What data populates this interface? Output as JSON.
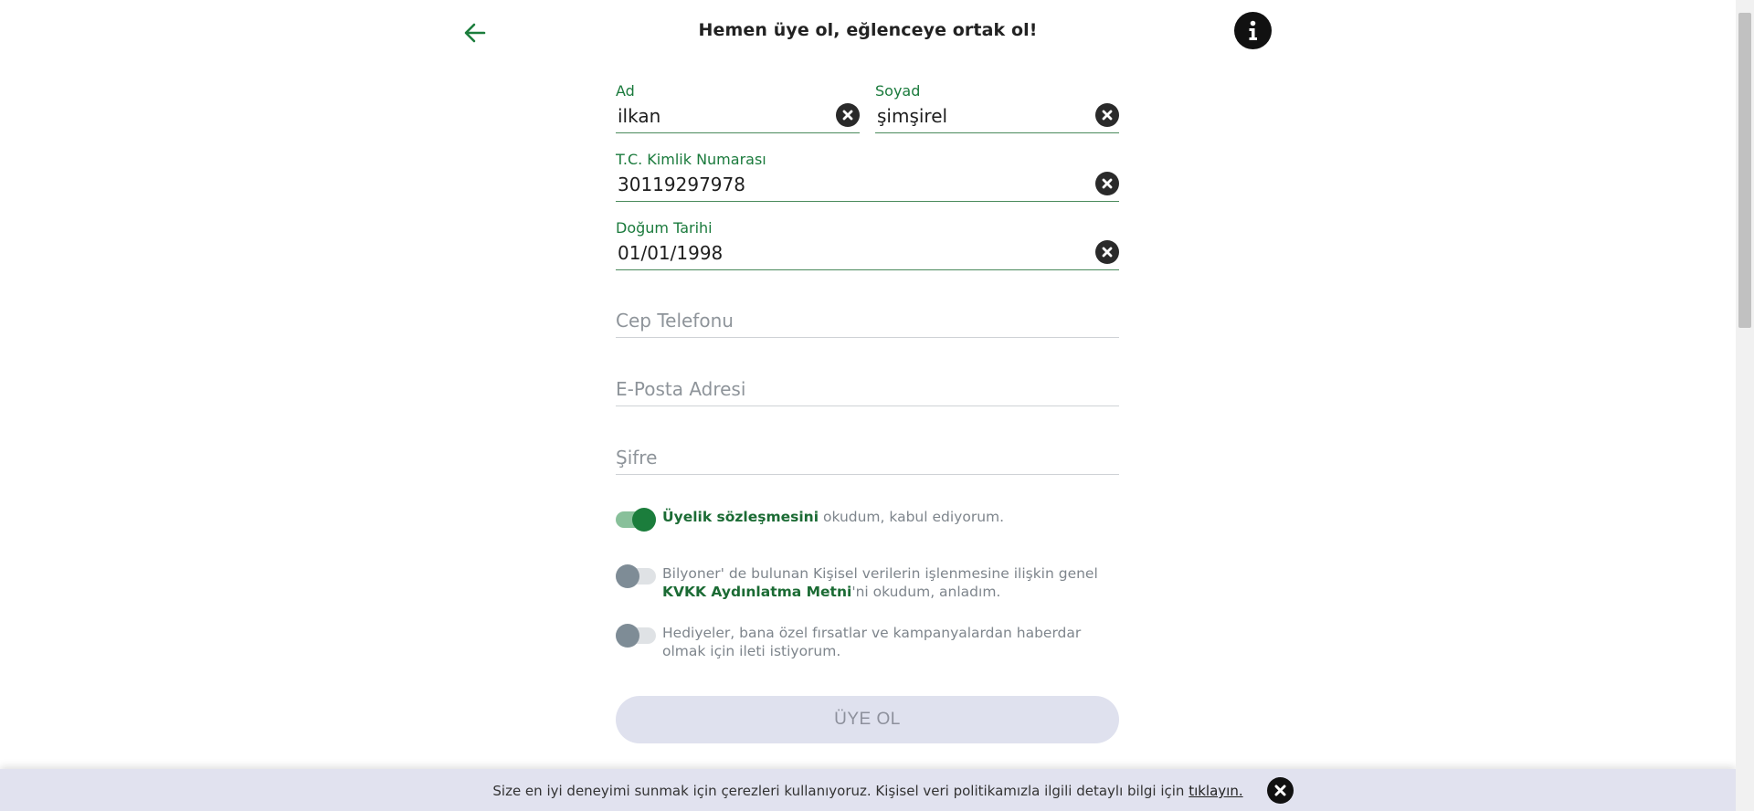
{
  "header": {
    "title": "Hemen üye ol, eğlenceye ortak ol!",
    "back_icon": "arrow-left-icon",
    "info_icon": "info-icon"
  },
  "form": {
    "first_name": {
      "label": "Ad",
      "value": "ilkan"
    },
    "last_name": {
      "label": "Soyad",
      "value": "şimşirel"
    },
    "tc_id": {
      "label": "T.C. Kimlik Numarası",
      "value": "30119297978"
    },
    "birth_date": {
      "label": "Doğum Tarihi",
      "value": "01/01/1998"
    },
    "phone": {
      "placeholder": "Cep Telefonu"
    },
    "email": {
      "placeholder": "E-Posta Adresi"
    },
    "password": {
      "placeholder": "Şifre"
    }
  },
  "consents": [
    {
      "checked": true,
      "link": "Üyelik sözleşmesini",
      "text": " okudum, kabul ediyorum."
    },
    {
      "checked": false,
      "text_before": "Bilyoner' de bulunan Kişisel verilerin işlenmesine ilişkin genel ",
      "link": "KVKK Aydınlatma Metni",
      "text_after": "'ni okudum, anladım."
    },
    {
      "checked": false,
      "text": "Hediyeler, bana özel fırsatlar ve kampanyalardan haberdar olmak için ileti istiyorum."
    }
  ],
  "submit_label": "ÜYE OL",
  "cookie": {
    "text": "Size en iyi deneyimi sunmak için çerezleri kullanıyoruz. Kişisel veri politikamızla ilgili detaylı bilgi için ",
    "link": "tıklayın."
  },
  "colors": {
    "accent_green": "#1b7d3c",
    "submit_bg": "#dfe1ee",
    "cookie_bg": "#e1e2ef"
  }
}
